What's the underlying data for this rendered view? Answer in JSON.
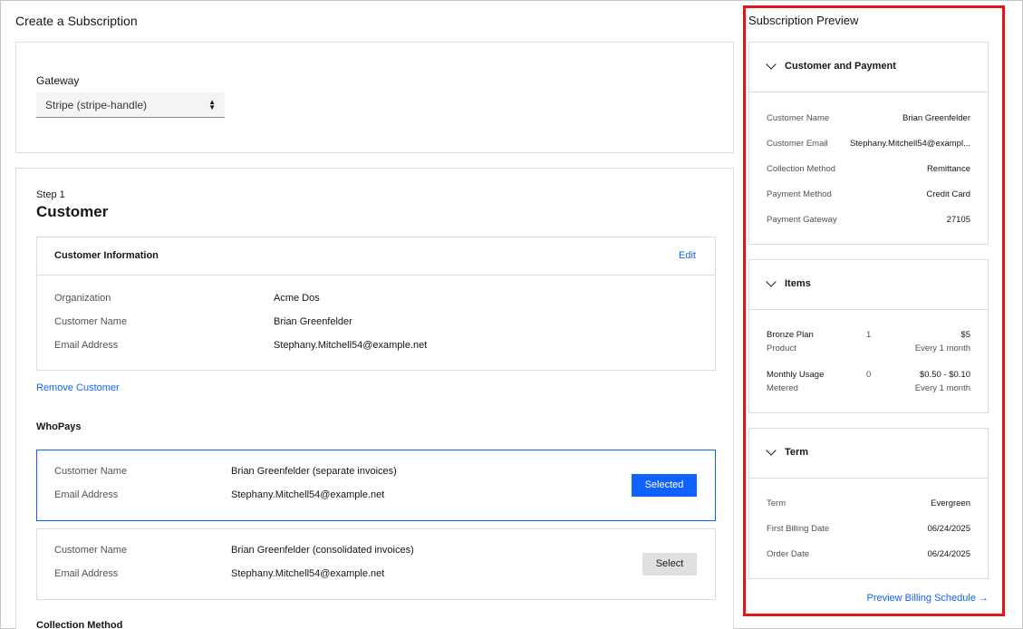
{
  "page": {
    "title": "Create a Subscription"
  },
  "gateway": {
    "label": "Gateway",
    "value": "Stripe (stripe-handle)"
  },
  "step": {
    "label": "Step 1",
    "title": "Customer"
  },
  "customer_info": {
    "title": "Customer Information",
    "edit_label": "Edit",
    "rows": [
      {
        "label": "Organization",
        "value": "Acme Dos"
      },
      {
        "label": "Customer Name",
        "value": "Brian Greenfelder"
      },
      {
        "label": "Email Address",
        "value": "Stephany.Mitchell54@example.net"
      }
    ]
  },
  "remove_customer_label": "Remove Customer",
  "who_pays": {
    "title": "WhoPays",
    "options": [
      {
        "name_label": "Customer Name",
        "name_value": "Brian Greenfelder (separate invoices)",
        "email_label": "Email Address",
        "email_value": "Stephany.Mitchell54@example.net",
        "button": "Selected"
      },
      {
        "name_label": "Customer Name",
        "name_value": "Brian Greenfelder (consolidated invoices)",
        "email_label": "Email Address",
        "email_value": "Stephany.Mitchell54@example.net",
        "button": "Select"
      }
    ]
  },
  "collection_method_title": "Collection Method",
  "preview": {
    "title": "Subscription Preview",
    "customer_payment": {
      "title": "Customer and Payment",
      "rows": [
        {
          "label": "Customer Name",
          "value": "Brian Greenfelder"
        },
        {
          "label": "Customer Email",
          "value": "Stephany.Mitchell54@exampl..."
        },
        {
          "label": "Collection Method",
          "value": "Remittance"
        },
        {
          "label": "Payment Method",
          "value": "Credit Card"
        },
        {
          "label": "Payment Gateway",
          "value": "27105"
        }
      ]
    },
    "items": {
      "title": "Items",
      "rows": [
        {
          "name": "Bronze Plan",
          "type": "Product",
          "qty": "1",
          "price": "$5",
          "freq": "Every 1 month"
        },
        {
          "name": "Monthly Usage",
          "type": "Metered",
          "qty": "0",
          "price": "$0.50 - $0.10",
          "freq": "Every 1 month"
        }
      ]
    },
    "term": {
      "title": "Term",
      "rows": [
        {
          "label": "Term",
          "value": "Evergreen"
        },
        {
          "label": "First Billing Date",
          "value": "06/24/2025"
        },
        {
          "label": "Order Date",
          "value": "06/24/2025"
        }
      ]
    },
    "schedule_link": "Preview Billing Schedule",
    "schedule_arrow": "→"
  },
  "colors": {
    "accent": "#0f62fe",
    "highlight_outline": "#e0171a"
  },
  "icons": {
    "select_caret": "sort-caret-icon",
    "section_toggle": "chevron-down-icon",
    "link_arrow": "arrow-right-icon"
  }
}
